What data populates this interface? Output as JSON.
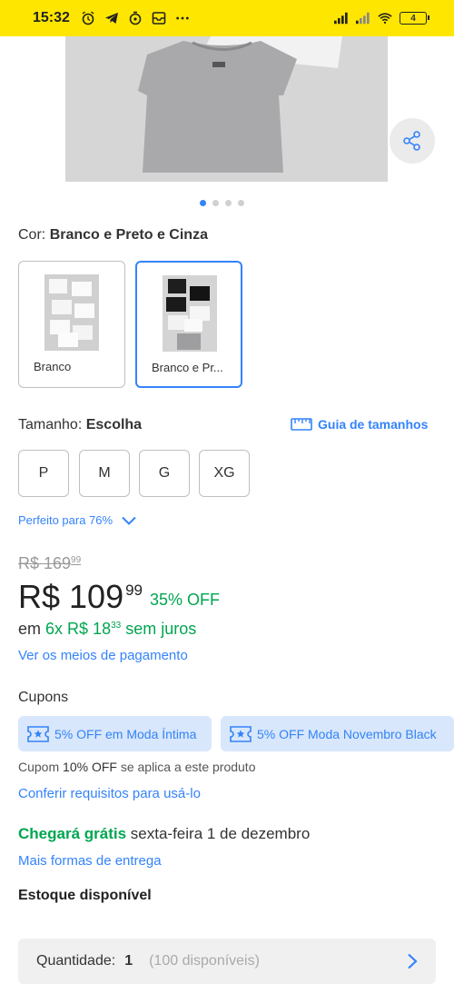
{
  "status_bar": {
    "time": "15:32",
    "battery": "4",
    "icons": [
      "alarm-icon",
      "telegram-icon",
      "timer-icon",
      "mail-icon",
      "more-icon",
      "signal-icon",
      "signal-icon",
      "wifi-icon",
      "battery-icon"
    ]
  },
  "gallery": {
    "dots": 4,
    "active_dot": 0
  },
  "color": {
    "label": "Cor:",
    "value": "Branco e Preto e Cinza",
    "options": [
      {
        "label": "Branco",
        "selected": false
      },
      {
        "label": "Branco e Pr...",
        "selected": true
      }
    ]
  },
  "size": {
    "label": "Tamanho:",
    "value": "Escolha",
    "guide_link": "Guia de tamanhos",
    "options": [
      "P",
      "M",
      "G",
      "XG"
    ],
    "fit_text": "Perfeito para 76%"
  },
  "price": {
    "original_prefix": "R$ 169",
    "original_cents": "99",
    "current_prefix": "R$ 109",
    "current_cents": "99",
    "discount": "35% OFF",
    "installments_prefix": "em",
    "installments_main": "6x R$ 18",
    "installments_cents": "33",
    "installments_suffix": "sem juros",
    "payment_link": "Ver os meios de pagamento"
  },
  "coupons": {
    "title": "Cupons",
    "items": [
      "5% OFF em Moda Íntima",
      "5% OFF Moda Novembro Black"
    ],
    "note_prefix": "Cupom",
    "note_bold": "10% OFF",
    "note_suffix": "se aplica a este produto",
    "requirements_link": "Conferir requisitos para usá-lo"
  },
  "delivery": {
    "highlight": "Chegará grátis",
    "date": "sexta-feira 1 de dezembro",
    "more_link": "Mais formas de entrega"
  },
  "stock": {
    "title": "Estoque disponível",
    "quantity_label": "Quantidade:",
    "quantity_value": "1",
    "available": "(100 disponíveis)"
  },
  "colors": {
    "accent": "#3483fa",
    "green": "#00a650",
    "status_bar": "#ffe600"
  }
}
